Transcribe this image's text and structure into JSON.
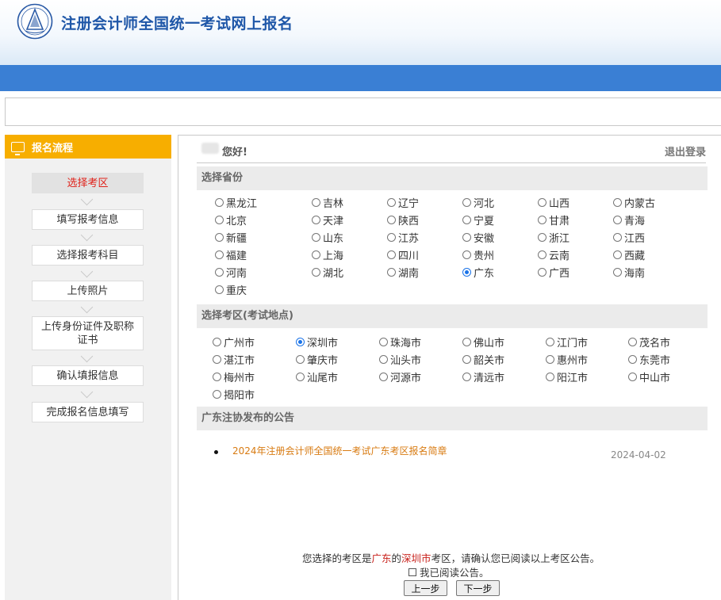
{
  "header": {
    "site_title": "注册会计师全国统一考试网上报名"
  },
  "sidebar": {
    "title": "报名流程",
    "steps": [
      "选择考区",
      "填写报考信息",
      "选择报考科目",
      "上传照片",
      "上传身份证件及职称证书",
      "确认填报信息",
      "完成报名信息填写"
    ],
    "active_step": 0
  },
  "user": {
    "greeting": "您好!",
    "logout": "退出登录"
  },
  "province_section": {
    "title": "选择省份",
    "options": [
      "黑龙江",
      "吉林",
      "辽宁",
      "河北",
      "山西",
      "内蒙古",
      "北京",
      "天津",
      "陕西",
      "宁夏",
      "甘肃",
      "青海",
      "新疆",
      "山东",
      "江苏",
      "安徽",
      "浙江",
      "江西",
      "福建",
      "上海",
      "四川",
      "贵州",
      "云南",
      "西藏",
      "河南",
      "湖北",
      "湖南",
      "广东",
      "广西",
      "海南",
      "重庆"
    ],
    "selected": "广东"
  },
  "city_section": {
    "title": "选择考区(考试地点)",
    "options": [
      "广州市",
      "深圳市",
      "珠海市",
      "佛山市",
      "江门市",
      "茂名市",
      "湛江市",
      "肇庆市",
      "汕头市",
      "韶关市",
      "惠州市",
      "东莞市",
      "梅州市",
      "汕尾市",
      "河源市",
      "清远市",
      "阳江市",
      "中山市",
      "揭阳市"
    ],
    "selected": "深圳市"
  },
  "notice_section": {
    "title": "广东注协发布的公告",
    "items": [
      {
        "title": "2024年注册会计师全国统一考试广东考区报名简章",
        "date": "2024-04-02"
      }
    ]
  },
  "confirm": {
    "prefix": "您选择的考区是",
    "province": "广东",
    "connector": "的",
    "city": "深圳市",
    "suffix": "考区，请确认您已阅读以上考区公告。",
    "checkbox_label": "我已阅读公告。",
    "prev_button": "上一步",
    "next_button": "下一步"
  },
  "colors": {
    "accent_blue": "#3a7fd4",
    "sidebar_header": "#f7ae00",
    "title_blue": "#1f57a8",
    "active_step": "#e0221a",
    "notice_link": "#d87b12"
  }
}
